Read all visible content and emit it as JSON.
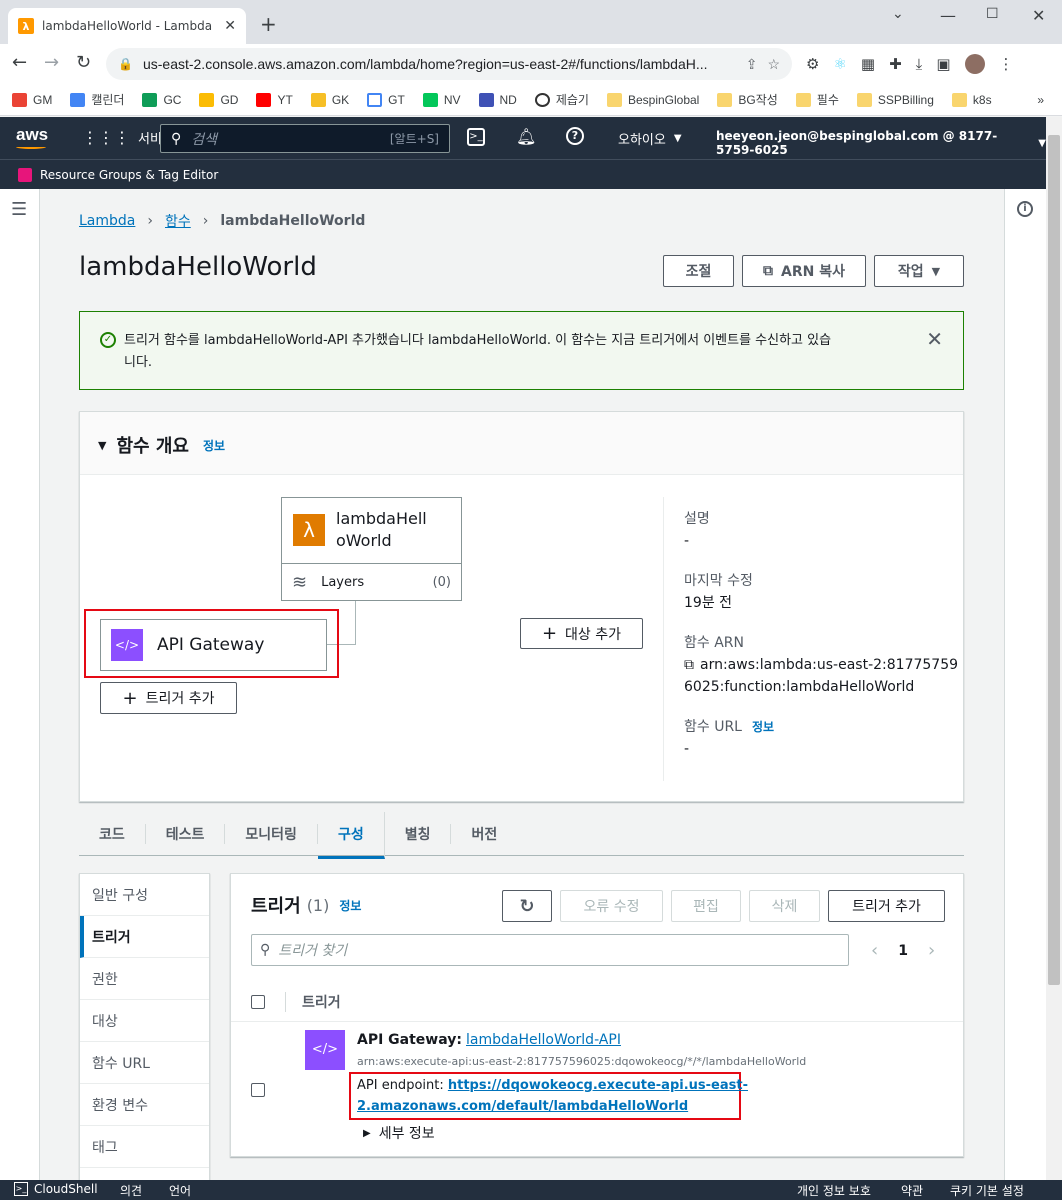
{
  "browser": {
    "tab_title": "lambdaHelloWorld - Lambda",
    "url": "us-east-2.console.aws.amazon.com/lambda/home?region=us-east-2#/functions/lambdaH...",
    "bookmarks": [
      "GM",
      "캘린더",
      "GC",
      "GD",
      "YT",
      "GK",
      "GT",
      "NV",
      "ND",
      "제습기",
      "BespinGlobal",
      "BG작성",
      "필수",
      "SSPBilling",
      "k8s"
    ]
  },
  "aws_nav": {
    "logo": "aws",
    "services": "서비스",
    "search_placeholder": "검색",
    "search_shortcut": "[알트+S]",
    "region": "오하이오",
    "account": "heeyeon.jeon@bespinglobal.com @ 8177-5759-6025",
    "resource_groups": "Resource Groups & Tag Editor"
  },
  "breadcrumb": {
    "lambda": "Lambda",
    "functions": "함수",
    "current": "lambdaHelloWorld"
  },
  "page": {
    "title": "lambdaHelloWorld",
    "throttle_button": "조절",
    "copy_arn_button": "ARN 복사",
    "actions_button": "작업"
  },
  "alert": {
    "message_line1": "트리거 함수를 lambdaHelloWorld-API 추가했습니다 lambdaHelloWorld. 이 함수는 지금 트리거에서 이벤트를 수신하고 있습",
    "message_line2": "니다."
  },
  "overview": {
    "title": "함수 개요",
    "info": "정보",
    "function_name_line1": "lambdaHell",
    "function_name_line2": "oWorld",
    "layers_label": "Layers",
    "layers_count": "(0)",
    "trigger_name": "API Gateway",
    "add_trigger": "트리거 추가",
    "add_destination": "대상 추가",
    "description_label": "설명",
    "description_value": "-",
    "last_modified_label": "마지막 수정",
    "last_modified_value": "19분 전",
    "arn_label": "함수 ARN",
    "arn_line1": "arn:aws:lambda:us-east-2:81775759",
    "arn_line2": "6025:function:lambdaHelloWorld",
    "url_label": "함수 URL",
    "url_info": "정보",
    "url_value": "-"
  },
  "tabs": [
    "코드",
    "테스트",
    "모니터링",
    "구성",
    "별칭",
    "버전"
  ],
  "active_tab": "구성",
  "config_menu": [
    "일반 구성",
    "트리거",
    "권한",
    "대상",
    "함수 URL",
    "환경 변수",
    "태그"
  ],
  "active_config": "트리거",
  "triggers": {
    "title": "트리거",
    "count": "(1)",
    "info": "정보",
    "fix_errors": "오류 수정",
    "edit": "편집",
    "delete": "삭제",
    "add": "트리거 추가",
    "search_placeholder": "트리거 찾기",
    "page": "1",
    "column_header": "트리거",
    "row": {
      "service": "API Gateway",
      "service_sep": ":",
      "api_name": "lambdaHelloWorld-API",
      "arn": "arn:aws:execute-api:us-east-2:817757596025:dqowokeocg/*/*/lambdaHelloWorld",
      "endpoint_label": "API endpoint:",
      "endpoint_line1": "https://dqowokeocg.execute-api.us-east-",
      "endpoint_line2": "2.amazonaws.com/default/lambdaHelloWorld",
      "details": "세부 정보"
    }
  },
  "footer": {
    "cloudshell": "CloudShell",
    "feedback": "의견",
    "language": "언어",
    "privacy": "개인 정보 보호",
    "terms": "약관",
    "cookies": "쿠키 기본 설정"
  },
  "colors": {
    "aws_nav": "#232f3e",
    "link": "#0073bb",
    "success": "#1d8102",
    "lambda_orange": "#e07b00",
    "apigw_purple": "#8c4fff",
    "highlight_red": "#e50914"
  }
}
